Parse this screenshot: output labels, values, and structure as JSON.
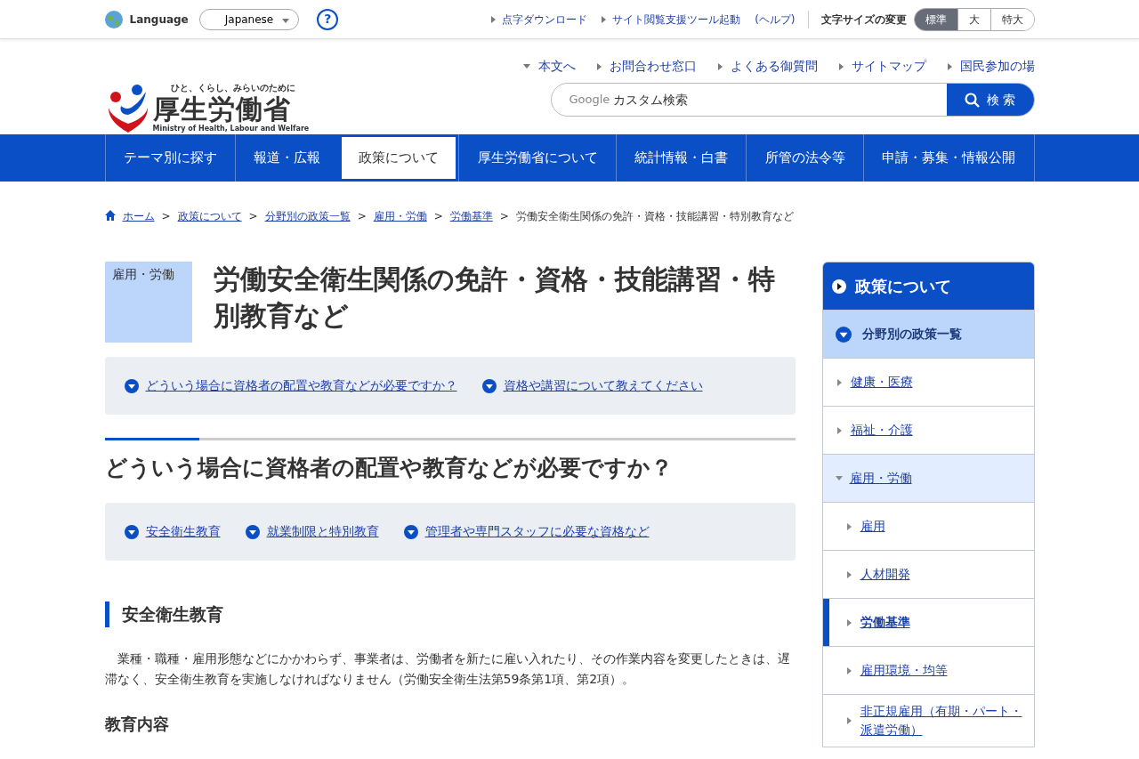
{
  "utility_bar": {
    "language_label": "Language",
    "language_select": "Japanese",
    "help": "?",
    "links": [
      {
        "label": "点字ダウンロード",
        "kind": "arrow"
      },
      {
        "label": "サイト閲覧支援ツール起動",
        "kind": "arrow"
      },
      {
        "label": "(ヘルプ)",
        "kind": "plain"
      }
    ],
    "font_size_label": "文字サイズの変更",
    "font_sizes": [
      {
        "label": "標準",
        "selected": true
      },
      {
        "label": "大",
        "selected": false
      },
      {
        "label": "特大",
        "selected": false
      }
    ]
  },
  "header": {
    "tagline": "ひと、くらし、みらいのために",
    "ministry": "厚生労働省",
    "ministry_en": "Ministry of Health, Labour and Welfare",
    "links": [
      {
        "label": "本文へ",
        "kind": "down"
      },
      {
        "label": "お問合わせ窓口",
        "kind": "right"
      },
      {
        "label": "よくある御質問",
        "kind": "right"
      },
      {
        "label": "サイトマップ",
        "kind": "right"
      },
      {
        "label": "国民参加の場",
        "kind": "right"
      }
    ],
    "search": {
      "brand": "Google",
      "placeholder": "カスタム検索",
      "button": "検 索"
    }
  },
  "main_nav": [
    {
      "label": "テーマ別に探す",
      "selected": false
    },
    {
      "label": "報道・広報",
      "selected": false
    },
    {
      "label": "政策について",
      "selected": true
    },
    {
      "label": "厚生労働省について",
      "selected": false
    },
    {
      "label": "統計情報・白書",
      "selected": false
    },
    {
      "label": "所管の法令等",
      "selected": false
    },
    {
      "label": "申請・募集・情報公開",
      "selected": false
    }
  ],
  "breadcrumb_separator": ">",
  "breadcrumb": [
    {
      "label": "ホーム",
      "link": true
    },
    {
      "label": "政策について",
      "link": true
    },
    {
      "label": "分野別の政策一覧",
      "link": true
    },
    {
      "label": "雇用・労働",
      "link": true
    },
    {
      "label": "労働基準",
      "link": true
    },
    {
      "label": "労働安全衛生関係の免許・資格・技能講習・特別教育など",
      "link": false
    }
  ],
  "page": {
    "category": "雇用・労働",
    "title": "労働安全衛生関係の免許・資格・技能講習・特別教育など",
    "toc": [
      "どういう場合に資格者の配置や教育などが必要ですか？",
      "資格や講習について教えてください"
    ],
    "section_heading": "どういう場合に資格者の配置や教育などが必要ですか？",
    "section_toc": [
      "安全衛生教育",
      "就業制限と特別教育",
      "管理者や専門スタッフに必要な資格など"
    ],
    "subheading": "安全衛生教育",
    "paragraph": "業種・職種・雇用形態などにかかわらず、事業者は、労働者を新たに雇い入れたり、その作業内容を変更したときは、遅滞なく、安全衛生教育を実施しなければなりません（労働安全衛生法第59条第1項、第2項）。",
    "minor_heading": "教育内容"
  },
  "sidebar": {
    "title": "政策について",
    "items": [
      {
        "label": "分野別の政策一覧",
        "expanded": true,
        "selected": false,
        "children": [
          {
            "label": "健康・医療",
            "expanded": false,
            "selected": false
          },
          {
            "label": "福祉・介護",
            "expanded": false,
            "selected": false
          },
          {
            "label": "雇用・労働",
            "expanded": true,
            "selected": false,
            "children": [
              {
                "label": "雇用",
                "expanded": false,
                "selected": false
              },
              {
                "label": "人材開発",
                "expanded": false,
                "selected": false
              },
              {
                "label": "労働基準",
                "expanded": false,
                "selected": true
              },
              {
                "label": "雇用環境・均等",
                "expanded": false,
                "selected": false
              },
              {
                "label": "非正規雇用（有期・パート・派遣労働）",
                "expanded": false,
                "selected": false
              }
            ]
          }
        ]
      }
    ]
  }
}
